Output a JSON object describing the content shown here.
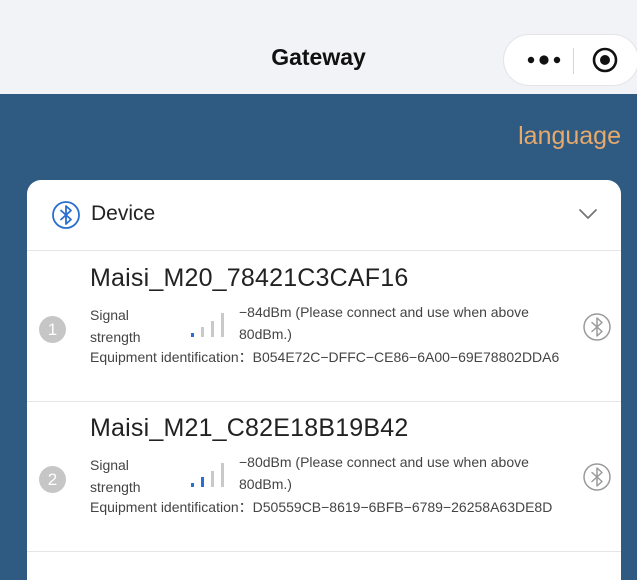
{
  "window": {
    "title": "Gateway"
  },
  "header": {
    "language_label": "language"
  },
  "device_section": {
    "title": "Device",
    "expanded": true
  },
  "devices": [
    {
      "index": "1",
      "name": "Maisi_M20_78421C3CAF16",
      "signal_label": "Signal strength",
      "signal_text": "−84dBm  (Please connect and use when above 80dBm.)",
      "signal_level_bars": 1,
      "equipment_text": "Equipment identification：B054E72C−DFFC−CE86−6A00−69E78802DDA6"
    },
    {
      "index": "2",
      "name": "Maisi_M21_C82E18B19B42",
      "signal_label": "Signal strength",
      "signal_text": "−80dBm  (Please connect and use when above 80dBm.)",
      "signal_level_bars": 2,
      "equipment_text": "Equipment identification：D50559CB−8619−6BFB−6789−26258A63DE8D"
    }
  ],
  "colors": {
    "header_bg": "#2f5b83",
    "language": "#e8a96a",
    "signal_active": "#2a6fcf",
    "signal_inactive": "#c9c9c9",
    "bluetooth_icon": "#2a6fcf"
  },
  "icons": {
    "more": "more-dots-icon",
    "close": "record-close-icon",
    "bluetooth": "bluetooth-icon",
    "chevron": "chevron-down-icon"
  }
}
